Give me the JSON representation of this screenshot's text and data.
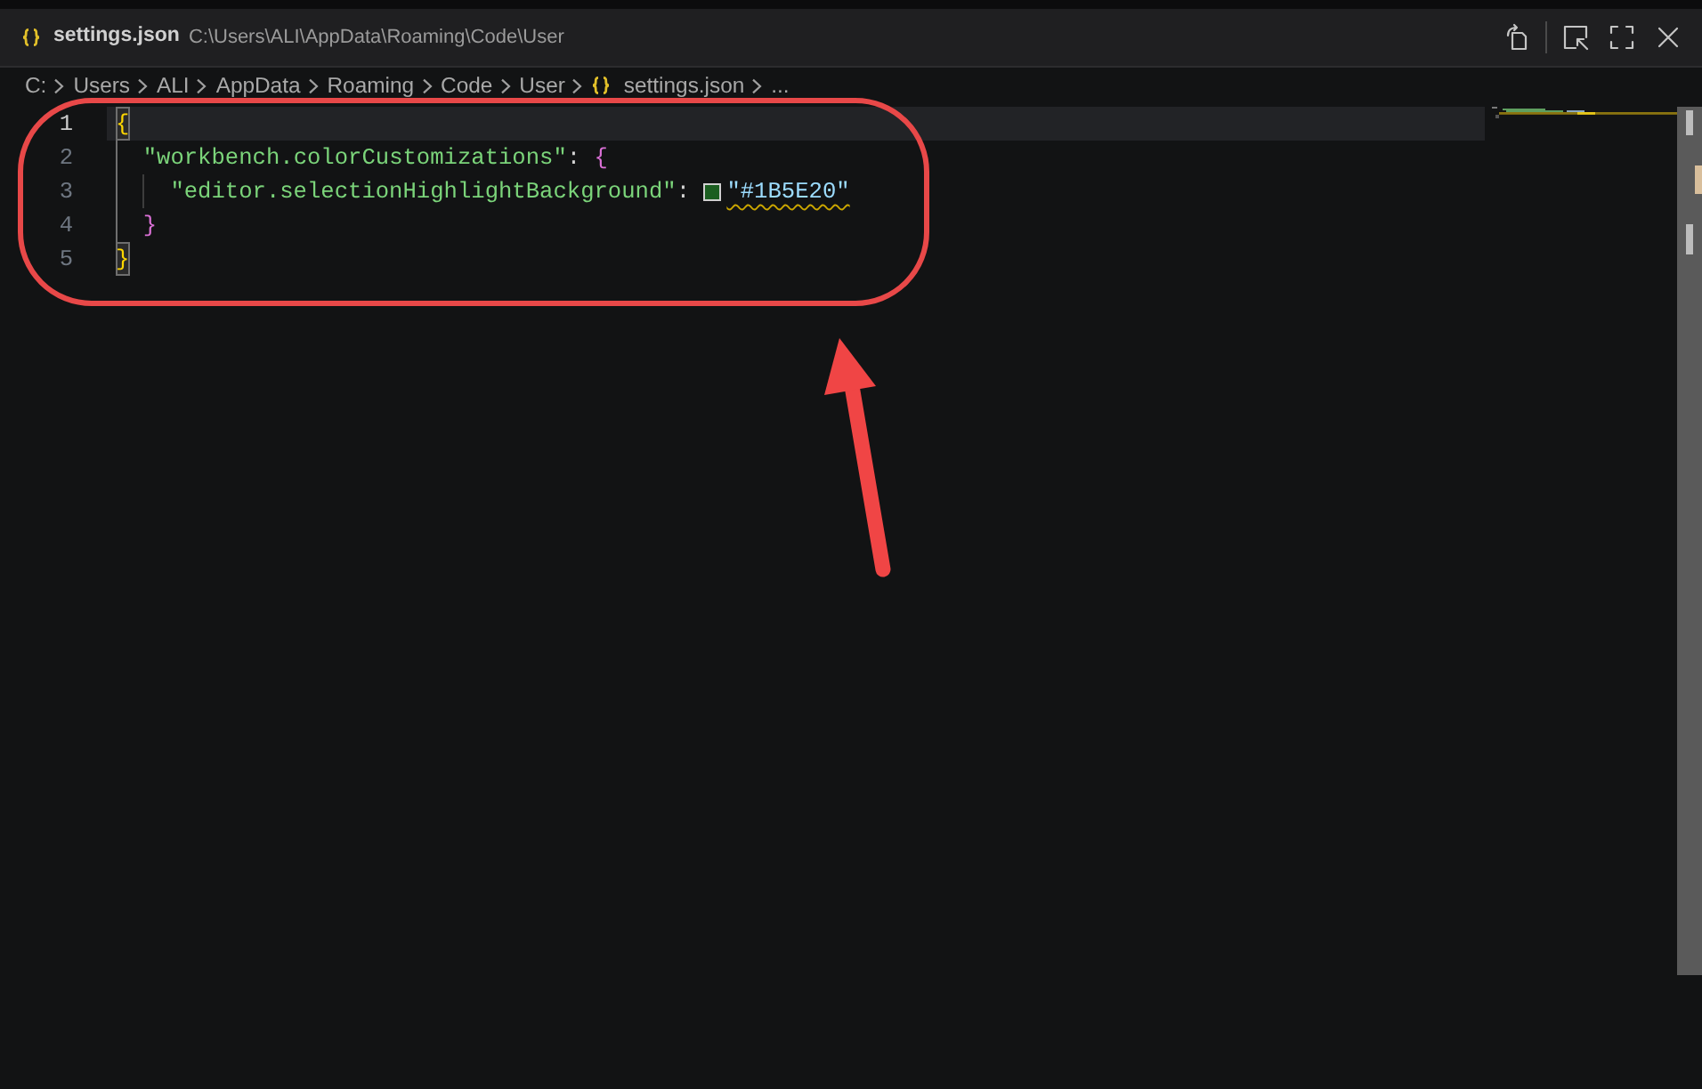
{
  "window": {
    "title": "settings.json",
    "path": "C:\\Users\\ALI\\AppData\\Roaming\\Code\\User"
  },
  "breadcrumb": [
    {
      "kind": "folder",
      "label": "C:"
    },
    {
      "kind": "folder",
      "label": "Users"
    },
    {
      "kind": "folder",
      "label": "ALI"
    },
    {
      "kind": "folder",
      "label": "AppData"
    },
    {
      "kind": "folder",
      "label": "Roaming"
    },
    {
      "kind": "folder",
      "label": "Code"
    },
    {
      "kind": "folder",
      "label": "User"
    },
    {
      "kind": "file",
      "label": "settings.json"
    },
    {
      "kind": "more",
      "label": "..."
    }
  ],
  "editor": {
    "lines": [
      {
        "number": "1",
        "current": true,
        "warning": false,
        "tokens": [
          {
            "kind": "matched-bracket",
            "text": "{"
          }
        ],
        "children": [
          {
            "number": "2",
            "current": false,
            "warning": false,
            "tokens": [
              {
                "kind": "key",
                "text": "\"workbench.colorCustomizations\""
              },
              {
                "kind": "punct",
                "text": ":"
              },
              {
                "kind": "bracket",
                "text": "{"
              }
            ],
            "children": [
              {
                "number": "3",
                "current": false,
                "warning": true,
                "tokens": [
                  {
                    "kind": "key",
                    "text": "\"editor.selectionHighlightBackground\""
                  },
                  {
                    "kind": "punct",
                    "text": ":"
                  },
                  {
                    "kind": "swatch",
                    "color": "#1b5e20"
                  },
                  {
                    "kind": "value",
                    "text": "\"#1B5E20\""
                  }
                ]
              }
            ]
          },
          {
            "number": "4",
            "current": false,
            "warning": false,
            "tokens": [
              {
                "kind": "bracket",
                "text": "}"
              }
            ]
          }
        ]
      },
      {
        "number": "5",
        "current": false,
        "warning": false,
        "tokens": [
          {
            "kind": "matched-bracket",
            "text": "}"
          }
        ]
      }
    ]
  }
}
